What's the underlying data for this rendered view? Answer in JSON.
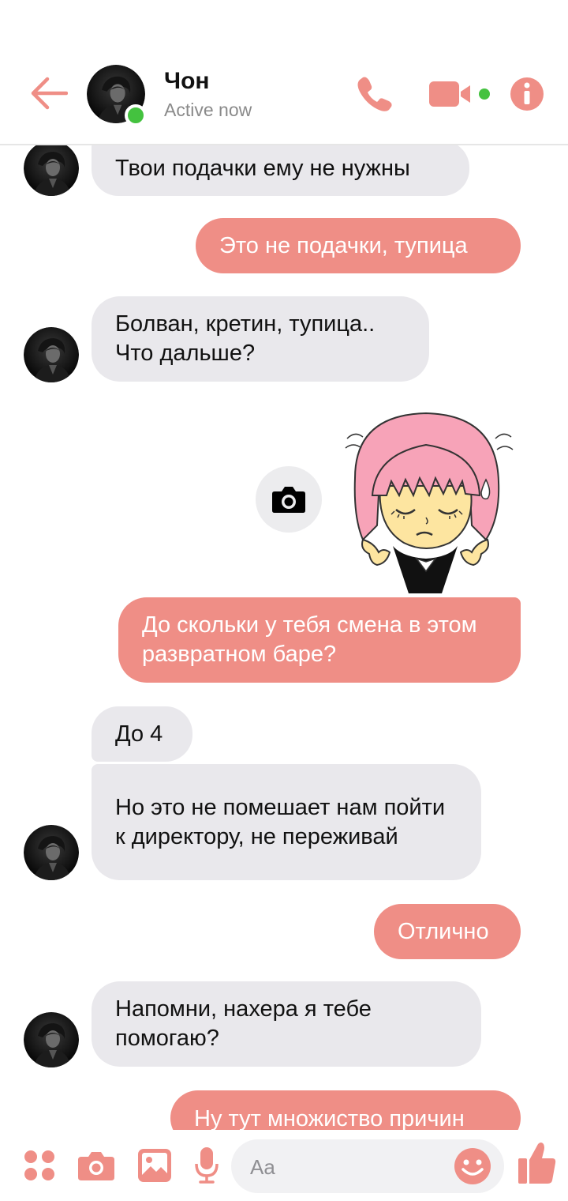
{
  "header": {
    "contact_name": "Чон",
    "status": "Active now"
  },
  "messages": [
    {
      "dir": "in",
      "text": "Твои подачки ему не нужны"
    },
    {
      "dir": "out",
      "text": "Это не подачки, тупица"
    },
    {
      "dir": "in",
      "text": "Болван, кретин, тупица.. Что дальше?"
    },
    {
      "dir": "out",
      "text": "До скольки у тебя смена в этом развратном баре?"
    },
    {
      "dir": "in",
      "text": "До 4"
    },
    {
      "dir": "in",
      "text": "Но это не помешает нам пойти к директору, не переживай"
    },
    {
      "dir": "out",
      "text": "Отлично"
    },
    {
      "dir": "in",
      "text": "Напомни, нахера я тебе помогаю?"
    },
    {
      "dir": "out",
      "text": "Ну тут множиство причин"
    }
  ],
  "composer": {
    "placeholder": "Aa"
  },
  "colors": {
    "accent": "#ef8e86",
    "incoming_bubble": "#e9e8ec",
    "online": "#44c23f"
  },
  "icons": [
    "back-arrow-icon",
    "phone-icon",
    "video-camera-icon",
    "info-icon",
    "camera-icon",
    "apps-icon",
    "gallery-icon",
    "microphone-icon",
    "emoji-icon",
    "thumbs-up-icon"
  ]
}
